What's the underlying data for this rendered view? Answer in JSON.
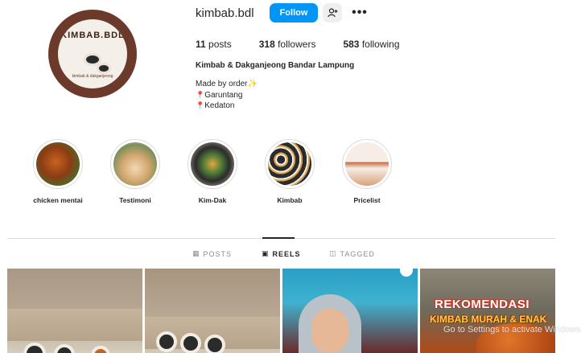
{
  "profile": {
    "username": "kimbab.bdl",
    "follow_label": "Follow",
    "avatar_text": "KIMBAB.BDL",
    "avatar_subtext": "kimbab & dakganjeong",
    "stats": {
      "posts_count": "11",
      "posts_label": "posts",
      "followers_count": "318",
      "followers_label": "followers",
      "following_count": "583",
      "following_label": "following"
    },
    "full_name": "Kimbab & Dakganjeong Bandar Lampung",
    "bio": {
      "line1": "Made by order",
      "line2": "Garuntang",
      "line3": "Kedaton"
    }
  },
  "highlights": [
    {
      "label": "chicken mentai"
    },
    {
      "label": "Testimoni"
    },
    {
      "label": "Kim-Dak"
    },
    {
      "label": "Kimbab"
    },
    {
      "label": "Pricelist"
    }
  ],
  "tabs": {
    "posts": "POSTS",
    "reels": "REELS",
    "tagged": "TAGGED"
  },
  "grid": {
    "promo_line1": "REKOMENDASI",
    "promo_line2": "KIMBAB MURAH & ENAK"
  },
  "overlay": {
    "watermark": "Go to Settings to activate Windows."
  },
  "colors": {
    "accent": "#0095f6",
    "avatar_ring": "#6b3a2a"
  }
}
